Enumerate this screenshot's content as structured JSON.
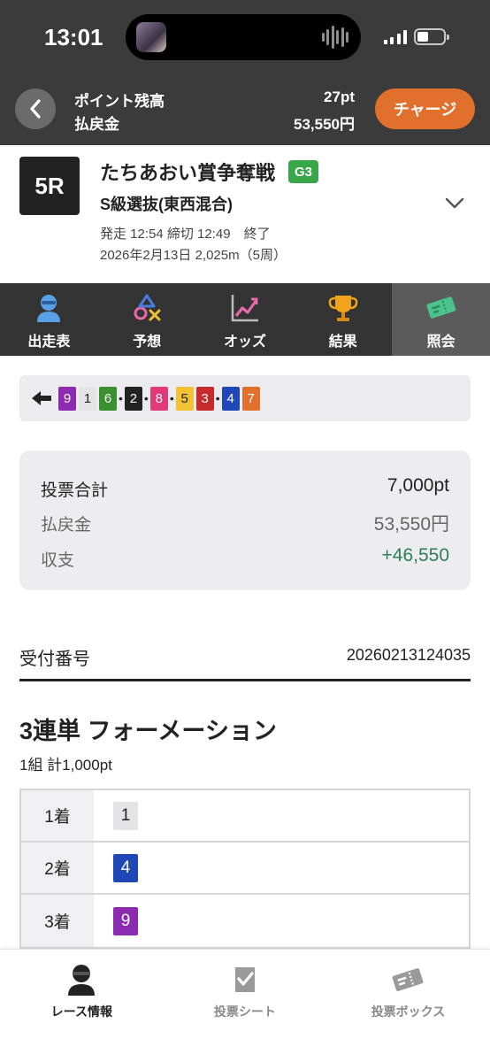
{
  "status_bar": {
    "time": "13:01"
  },
  "header": {
    "points_label": "ポイント残高",
    "points_value": "27pt",
    "payout_label": "払戻金",
    "payout_value": "53,550円",
    "charge_button": "チャージ"
  },
  "race": {
    "number": "5R",
    "title": "たちあおい賞争奪戦",
    "grade": "G3",
    "subtitle": "S級選抜(東西混合)",
    "schedule": "発走 12:54 締切 12:49　終了",
    "date_distance": "2026年2月13日 2,025m（5周）"
  },
  "tabs": [
    {
      "label": "出走表",
      "icon": "racer-icon"
    },
    {
      "label": "予想",
      "icon": "prediction-icon"
    },
    {
      "label": "オッズ",
      "icon": "odds-chart-icon"
    },
    {
      "label": "結果",
      "icon": "trophy-icon"
    },
    {
      "label": "照会",
      "icon": "ticket-icon"
    }
  ],
  "active_tab": 4,
  "combination": [
    {
      "num": "9",
      "bg": "#8b2bb0",
      "fg": "#ffffff"
    },
    {
      "num": "1",
      "bg": "#e4e4e6",
      "fg": "#222222"
    },
    {
      "num": "6",
      "bg": "#3a8f2e",
      "fg": "#ffffff",
      "dot_after": true
    },
    {
      "num": "2",
      "bg": "#222222",
      "fg": "#ffffff",
      "dot_after": true
    },
    {
      "num": "8",
      "bg": "#e13a7a",
      "fg": "#ffffff",
      "dot_after": true
    },
    {
      "num": "5",
      "bg": "#f2c232",
      "fg": "#222222"
    },
    {
      "num": "3",
      "bg": "#c72a2a",
      "fg": "#ffffff",
      "dot_after": true
    },
    {
      "num": "4",
      "bg": "#1f47b8",
      "fg": "#ffffff"
    },
    {
      "num": "7",
      "bg": "#e0702c",
      "fg": "#ffffff"
    }
  ],
  "summary": {
    "total_label": "投票合計",
    "total_value": "7,000pt",
    "payout_label": "払戻金",
    "payout_value": "53,550円",
    "balance_label": "収支",
    "balance_value": "+46,550"
  },
  "receipt": {
    "label": "受付番号",
    "number": "20260213124035"
  },
  "bet": {
    "title": "3連単 フォーメーション",
    "subtitle": "1組 計1,000pt",
    "rows": [
      {
        "label": "1着",
        "num": "1",
        "bg": "#e4e4e6",
        "fg": "#222222"
      },
      {
        "label": "2着",
        "num": "4",
        "bg": "#1f47b8",
        "fg": "#ffffff"
      },
      {
        "label": "3着",
        "num": "9",
        "bg": "#8b2bb0",
        "fg": "#ffffff"
      }
    ]
  },
  "bottom_nav": [
    {
      "label": "レース情報",
      "icon": "racer-icon"
    },
    {
      "label": "投票シート",
      "icon": "bet-sheet-icon"
    },
    {
      "label": "投票ボックス",
      "icon": "ticket-icon"
    }
  ],
  "active_bottom": 0
}
